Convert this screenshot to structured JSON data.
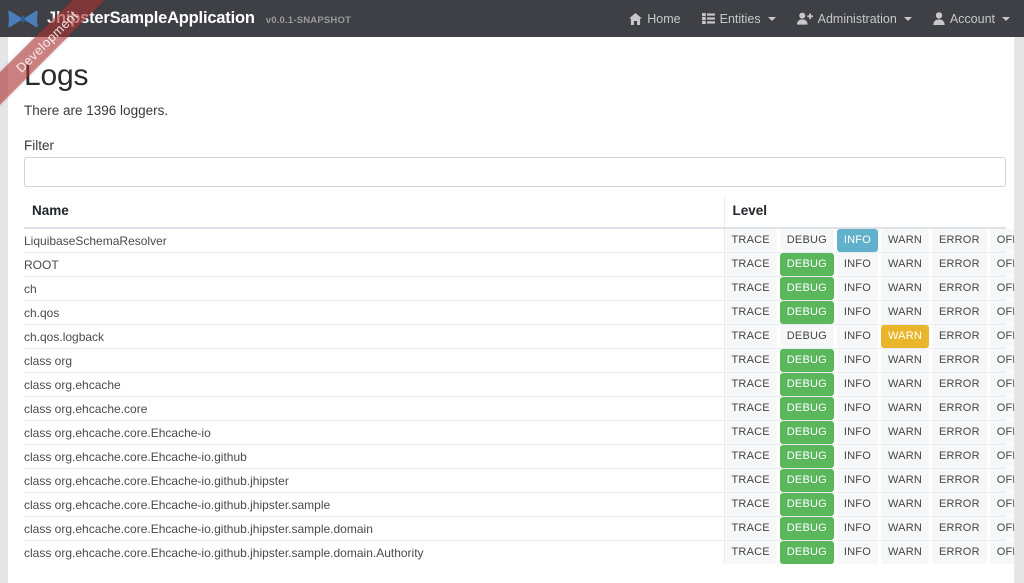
{
  "navbar": {
    "logo_icon": "jhipster-bowtie-logo-icon",
    "brand_title": "JhipsterSampleApplication",
    "brand_version": "v0.0.1-SNAPSHOT",
    "items": [
      {
        "label": "Home",
        "icon": "home-icon",
        "caret": false
      },
      {
        "label": "Entities",
        "icon": "list-icon",
        "caret": true
      },
      {
        "label": "Administration",
        "icon": "user-plus-icon",
        "caret": true
      },
      {
        "label": "Account",
        "icon": "user-icon",
        "caret": true
      }
    ]
  },
  "ribbon": {
    "label": "Development"
  },
  "page": {
    "title": "Logs",
    "loggers_count_text": "There are 1396 loggers.",
    "filter_label": "Filter",
    "filter_value": "",
    "filter_placeholder": ""
  },
  "table": {
    "columns": [
      "Name",
      "Level"
    ],
    "levels": [
      "TRACE",
      "DEBUG",
      "INFO",
      "WARN",
      "ERROR",
      "OFF"
    ],
    "rows": [
      {
        "name": "LiquibaseSchemaResolver",
        "level": "INFO"
      },
      {
        "name": "ROOT",
        "level": "DEBUG"
      },
      {
        "name": "ch",
        "level": "DEBUG"
      },
      {
        "name": "ch.qos",
        "level": "DEBUG"
      },
      {
        "name": "ch.qos.logback",
        "level": "WARN"
      },
      {
        "name": "class org",
        "level": "DEBUG"
      },
      {
        "name": "class org.ehcache",
        "level": "DEBUG"
      },
      {
        "name": "class org.ehcache.core",
        "level": "DEBUG"
      },
      {
        "name": "class org.ehcache.core.Ehcache-io",
        "level": "DEBUG"
      },
      {
        "name": "class org.ehcache.core.Ehcache-io.github",
        "level": "DEBUG"
      },
      {
        "name": "class org.ehcache.core.Ehcache-io.github.jhipster",
        "level": "DEBUG"
      },
      {
        "name": "class org.ehcache.core.Ehcache-io.github.jhipster.sample",
        "level": "DEBUG"
      },
      {
        "name": "class org.ehcache.core.Ehcache-io.github.jhipster.sample.domain",
        "level": "DEBUG"
      },
      {
        "name": "class org.ehcache.core.Ehcache-io.github.jhipster.sample.domain.Authority",
        "level": "DEBUG"
      }
    ]
  },
  "colors": {
    "navbar_bg": "#3e4045",
    "ribbon_bg": "#aa3232",
    "info": "#62b1cc",
    "success": "#5bb75b",
    "warning": "#e9b52b",
    "btn_default_bg": "#f6f7f8"
  }
}
